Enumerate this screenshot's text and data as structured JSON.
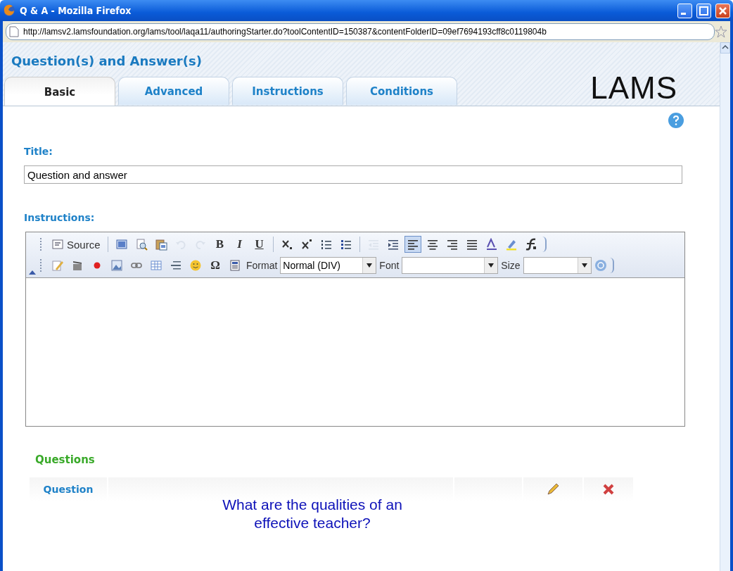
{
  "window": {
    "title": "Q & A - Mozilla Firefox"
  },
  "address_bar": {
    "url": "http://lamsv2.lamsfoundation.org/lams/tool/laqa11/authoringStarter.do?toolContentID=150387&contentFolderID=09ef7694193cff8c0119804b"
  },
  "page": {
    "heading": "Question(s) and Answer(s)",
    "logo": "LAMS"
  },
  "tabs": [
    {
      "label": "Basic",
      "selected": true
    },
    {
      "label": "Advanced",
      "selected": false
    },
    {
      "label": "Instructions",
      "selected": false
    },
    {
      "label": "Conditions",
      "selected": false
    }
  ],
  "title_field": {
    "label": "Title:",
    "value": "Question and answer"
  },
  "instructions": {
    "label": "Instructions:",
    "toolbar_row_1": [
      {
        "kind": "source",
        "label": "Source",
        "disabled": false,
        "selected": false
      },
      {
        "kind": "sep"
      },
      {
        "kind": "maximize",
        "disabled": false,
        "selected": false
      },
      {
        "kind": "preview",
        "disabled": false,
        "selected": false
      },
      {
        "kind": "paste",
        "disabled": false,
        "selected": false
      },
      {
        "kind": "undo",
        "disabled": true,
        "selected": false
      },
      {
        "kind": "redo",
        "disabled": true,
        "selected": false
      },
      {
        "kind": "bold",
        "label": "B",
        "disabled": false,
        "selected": false
      },
      {
        "kind": "italic",
        "label": "I",
        "disabled": false,
        "selected": false
      },
      {
        "kind": "underline",
        "label": "U",
        "disabled": false,
        "selected": false
      },
      {
        "kind": "sep"
      },
      {
        "kind": "subscript",
        "disabled": false,
        "selected": false
      },
      {
        "kind": "superscript",
        "disabled": false,
        "selected": false
      },
      {
        "kind": "numbered-list",
        "disabled": false,
        "selected": false
      },
      {
        "kind": "bulleted-list",
        "disabled": false,
        "selected": false
      },
      {
        "kind": "sep"
      },
      {
        "kind": "outdent",
        "disabled": true,
        "selected": false
      },
      {
        "kind": "indent",
        "disabled": false,
        "selected": false
      },
      {
        "kind": "align-left",
        "disabled": false,
        "selected": true
      },
      {
        "kind": "align-center",
        "disabled": false,
        "selected": false
      },
      {
        "kind": "align-right",
        "disabled": false,
        "selected": false
      },
      {
        "kind": "justify",
        "disabled": false,
        "selected": false
      },
      {
        "kind": "text-color",
        "disabled": false,
        "selected": false
      },
      {
        "kind": "highlight",
        "disabled": false,
        "selected": false
      },
      {
        "kind": "formula",
        "disabled": false,
        "selected": false
      }
    ],
    "toolbar_row_2": [
      {
        "kind": "edit",
        "disabled": false,
        "selected": false
      },
      {
        "kind": "clapper",
        "disabled": false,
        "selected": false
      },
      {
        "kind": "record",
        "disabled": false,
        "selected": false
      },
      {
        "kind": "image",
        "disabled": false,
        "selected": false
      },
      {
        "kind": "link",
        "disabled": false,
        "selected": false
      },
      {
        "kind": "table",
        "disabled": false,
        "selected": false
      },
      {
        "kind": "rule",
        "disabled": false,
        "selected": false
      },
      {
        "kind": "smiley",
        "disabled": false,
        "selected": false
      },
      {
        "kind": "omega",
        "label": "Ω",
        "disabled": false,
        "selected": false
      },
      {
        "kind": "template",
        "disabled": false,
        "selected": false
      }
    ],
    "format": {
      "label": "Format",
      "value": "Normal (DIV)"
    },
    "font": {
      "label": "Font"
    },
    "size": {
      "label": "Size"
    }
  },
  "questions": {
    "heading": "Questions",
    "rows": [
      {
        "label": "Question",
        "text": "What are the qualities of an effective teacher?"
      }
    ]
  }
}
